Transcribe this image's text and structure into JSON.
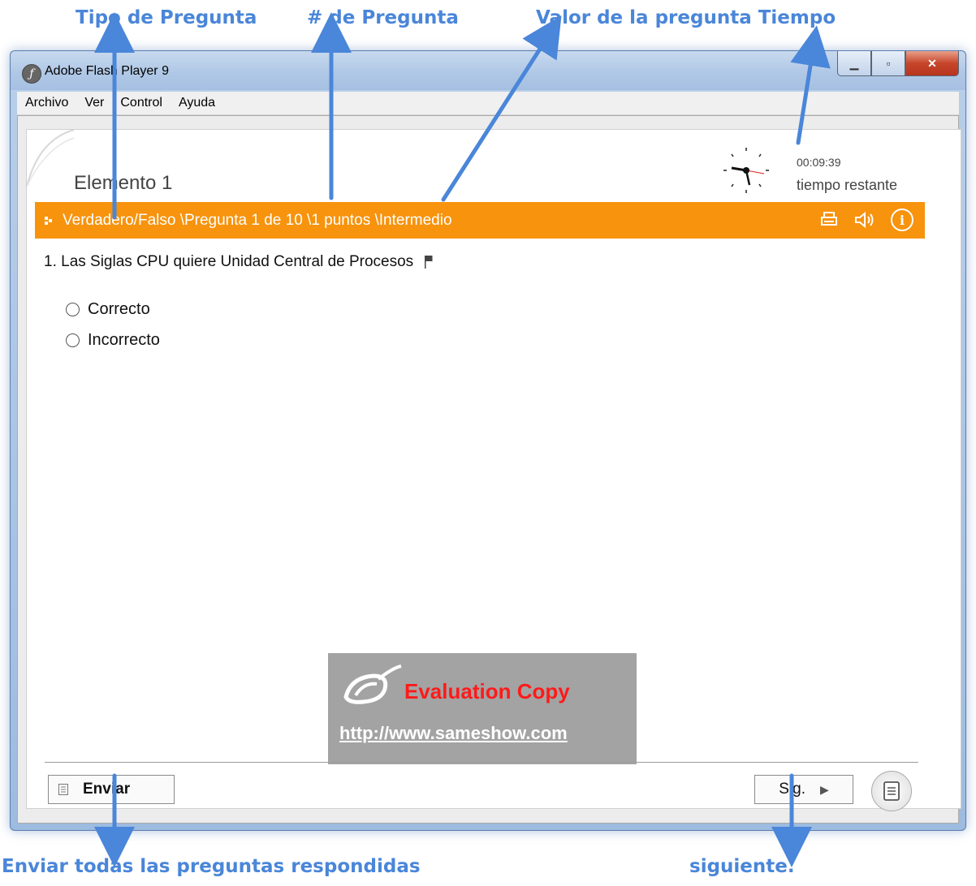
{
  "annotations": {
    "top": [
      "Tipo de Pregunta",
      "# de Pregunta",
      "Valor de la pregunta Tiempo"
    ],
    "bottom_left": "Enviar todas las preguntas respondidas",
    "bottom_right": "siguiente."
  },
  "window": {
    "title": "Adobe Flash Player 9",
    "controls": [
      "minimize-icon",
      "maximize-icon",
      "close-icon"
    ]
  },
  "menu": [
    "Archivo",
    "Ver",
    "Control",
    "Ayuda"
  ],
  "content": {
    "element_title": "Elemento 1",
    "timer": "00:09:39",
    "timer_label": "tiempo restante",
    "question_bar": "Verdadero/Falso \\Pregunta 1 de  10 \\1 puntos \\Intermedio",
    "question_bar_icons": [
      "print-icon",
      "speaker-icon",
      "info-icon"
    ],
    "question_text": "1.  Las Siglas CPU quiere Unidad Central de Procesos",
    "options": [
      "Correcto",
      "Incorrecto"
    ]
  },
  "watermark": {
    "title": "Evaluation Copy",
    "url": "http://www.sameshow.com"
  },
  "footer": {
    "send_label": "Enviar",
    "next_label": "Sig."
  },
  "colors": {
    "accent_orange": "#f7930d",
    "annotation_blue": "#4a86d9",
    "watermark_red": "#ff1a1a"
  }
}
